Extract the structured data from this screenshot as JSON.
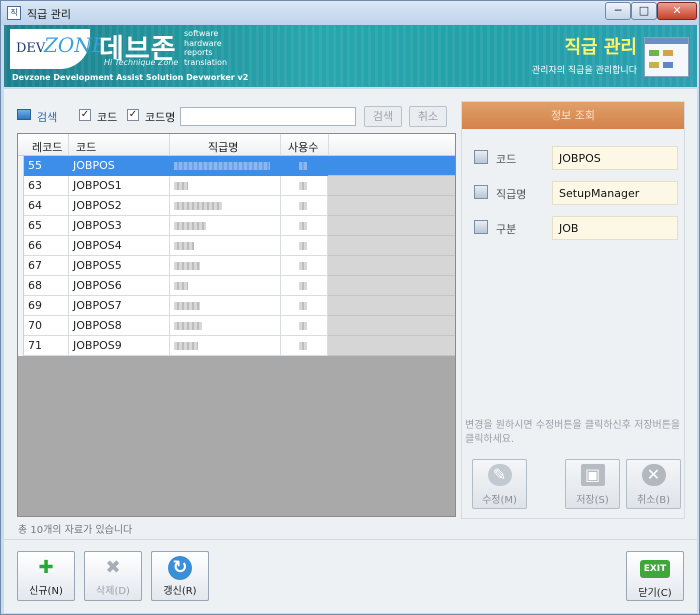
{
  "window": {
    "title": "직급 관리",
    "min": "─",
    "max": "□",
    "close": "✕",
    "app_icon": "직"
  },
  "banner": {
    "logo_dev": "DEV",
    "logo_zone": "ZONE",
    "brand": "데브존",
    "brand_sub": "Hi Technique Zone",
    "taglines": [
      "software",
      "hardware",
      "reports",
      "translation"
    ],
    "footer": "Devzone Development Assist Solution Devworker v2",
    "page_title": "직급 관리",
    "page_desc": "관리자의 직급을 관리합니다"
  },
  "search": {
    "label": "검색",
    "check_code": "코드",
    "check_code_checked": "✓",
    "check_name": "코드명",
    "check_name_checked": "✓",
    "input_value": "",
    "search_button": "검색",
    "cancel_button": "취소"
  },
  "grid": {
    "headers": [
      "레코드",
      "코드",
      "직급명",
      "사용수"
    ],
    "rows": [
      {
        "record": "55",
        "code": "JOBPOS",
        "selected": true
      },
      {
        "record": "63",
        "code": "JOBPOS1"
      },
      {
        "record": "64",
        "code": "JOBPOS2"
      },
      {
        "record": "65",
        "code": "JOBPOS3"
      },
      {
        "record": "66",
        "code": "JOBPOS4"
      },
      {
        "record": "67",
        "code": "JOBPOS5"
      },
      {
        "record": "68",
        "code": "JOBPOS6"
      },
      {
        "record": "69",
        "code": "JOBPOS7"
      },
      {
        "record": "70",
        "code": "JOBPOS8"
      },
      {
        "record": "71",
        "code": "JOBPOS9"
      }
    ]
  },
  "status": "총 10개의 자료가 있습니다",
  "info": {
    "header": "정보 조회",
    "code_label": "코드",
    "code_value": "JOBPOS",
    "name_label": "직급명",
    "name_value": "SetupManager",
    "type_label": "구분",
    "type_value": "JOB",
    "hint": "변경을 원하시면 수정버튼을 클릭하신후 저장버튼을 클릭하세요."
  },
  "actions": {
    "edit": "수정(M)",
    "save": "저장(S)",
    "cancel": "취소(B)"
  },
  "bottom": {
    "new": "신규(N)",
    "delete": "삭제(D)",
    "refresh": "갱신(R)",
    "close": "닫기(C)",
    "exit_badge": "EXIT"
  },
  "colors": {
    "banner": "#28a6ad",
    "selection": "#3d8ee8",
    "info_header": "#d4824a",
    "title_text": "#fff36a"
  }
}
